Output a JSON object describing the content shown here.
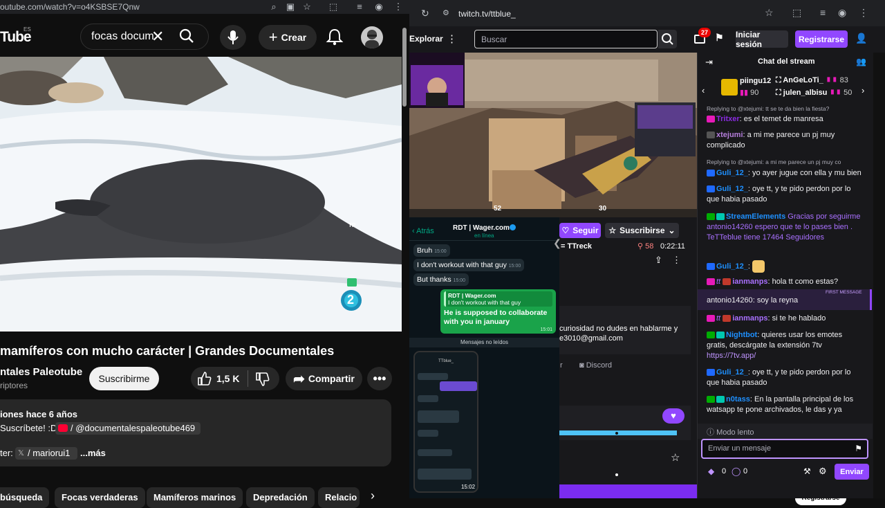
{
  "youtube": {
    "url": "outube.com/watch?v=o4KSBSE7Qnw",
    "logo": "Tube",
    "logo_region": "ES",
    "search_value": "focas docum",
    "create_label": "Crear",
    "video_title": "mamíferos con mucho carácter | Grandes Documentales",
    "channel_name": "ntales Paleotube",
    "subscribers": "riptores",
    "subscribe_label": "Suscribirme",
    "likes": "1,5 K",
    "share_label": "Compartir",
    "desc_line1": "iones  hace 6 años",
    "desc_line2": "Suscríbete! :D",
    "desc_link": "/ @documentalespaleotube469",
    "desc_line3_prefix": "ter:",
    "desc_line3_link": "/ mariorui1",
    "desc_more": "...más",
    "video_watermark": "TP",
    "video_channel_num": "2",
    "chips": [
      "búsqueda",
      "Focas verdaderas",
      "Mamíferos marinos",
      "Depredación",
      "Relacio"
    ],
    "colors": {
      "bg": "#0f0f0f",
      "chip": "#272727"
    }
  },
  "twitch": {
    "url": "twitch.tv/ttblue_",
    "explore_label": "Explorar",
    "search_placeholder": "Buscar",
    "notif_count": "27",
    "login_label": "Iniciar sesión",
    "register_label": "Registrarse",
    "chat_title": "Chat del stream",
    "follow_label": "Seguir",
    "subscribe_label": "Suscribirse",
    "streamer_tag": "= TTreck",
    "viewers": "58",
    "uptime": "0:22:11",
    "about_text": "curiosidad no dudes en hablarme y",
    "about_email": "e3010@gmail.com",
    "discord_label": "Discord",
    "slow_mode": "Modo lento",
    "chat_placeholder": "Enviar un mensaje",
    "send_label": "Enviar",
    "points_a": "0",
    "points_b": "0",
    "bottom_register": "Registrarse",
    "hud_left": "52",
    "hud_right": "30",
    "top_gifters": [
      {
        "name": "piingu12",
        "count": "90"
      },
      {
        "name": "AnGeLoTi_",
        "count": "83"
      },
      {
        "name": "julen_albisu",
        "count": "50"
      }
    ],
    "chat": [
      {
        "reply": "Replying to @xtejumi: tt se te da bien la fiesta?"
      },
      {
        "user": "Tritxer",
        "text": "es el temet de manresa"
      },
      {
        "user": "xtejumi",
        "text": "a mi me parece un pj muy complicado"
      },
      {
        "reply": "Replying to @xtejumi: a mi me parece un pj muy co"
      },
      {
        "user": "Guli_12_",
        "text": "yo ayer jugue con ella y mu bien"
      },
      {
        "user": "Guli_12_",
        "text": "oye tt, y te pido perdon por lo que habia pasado"
      },
      {
        "user": "StreamElements",
        "text": "Gracias por seguirme antonio14260   espero que te lo pases bien . TeTTeblue tiene 17464 Seguidores"
      },
      {
        "user": "Guli_12_",
        "text": ""
      },
      {
        "user": "ianmanps",
        "text": "hola tt como estas?"
      },
      {
        "first": "FIRST MESSAGE",
        "user": "antonio14260",
        "text": "soy la reyna"
      },
      {
        "user": "ianmanps",
        "text": "si te he hablado"
      },
      {
        "user": "Nightbot",
        "text": "quieres usar los emotes gratis, descárgate la extensión 7tv",
        "link": "https://7tv.app/"
      },
      {
        "user": "Guli_12_",
        "text": "oye tt, y te pido perdon por lo que habia pasado"
      },
      {
        "user": "n0tass",
        "text": "En la pantalla principal de los watsapp te pone archivados, le das y ya"
      }
    ]
  },
  "whatsapp": {
    "back_label": "Atrás",
    "contact": "RDT | Wager.com",
    "status": "en línea",
    "messages": [
      {
        "text": "Bruh",
        "time": "15:00"
      },
      {
        "text": "I don't workout with that guy",
        "time": "15:00"
      },
      {
        "text": "But thanks",
        "time": "15:00"
      }
    ],
    "quote_name": "RDT | Wager.com",
    "quote_text": "I don't workout with that guy",
    "sent_text": "He is supposed to collaborate with you in january",
    "sent_time": "15:01",
    "unread_label": "Mensajes no leídos",
    "phone_time": "15:02",
    "phone_contact": "TTblue_"
  }
}
